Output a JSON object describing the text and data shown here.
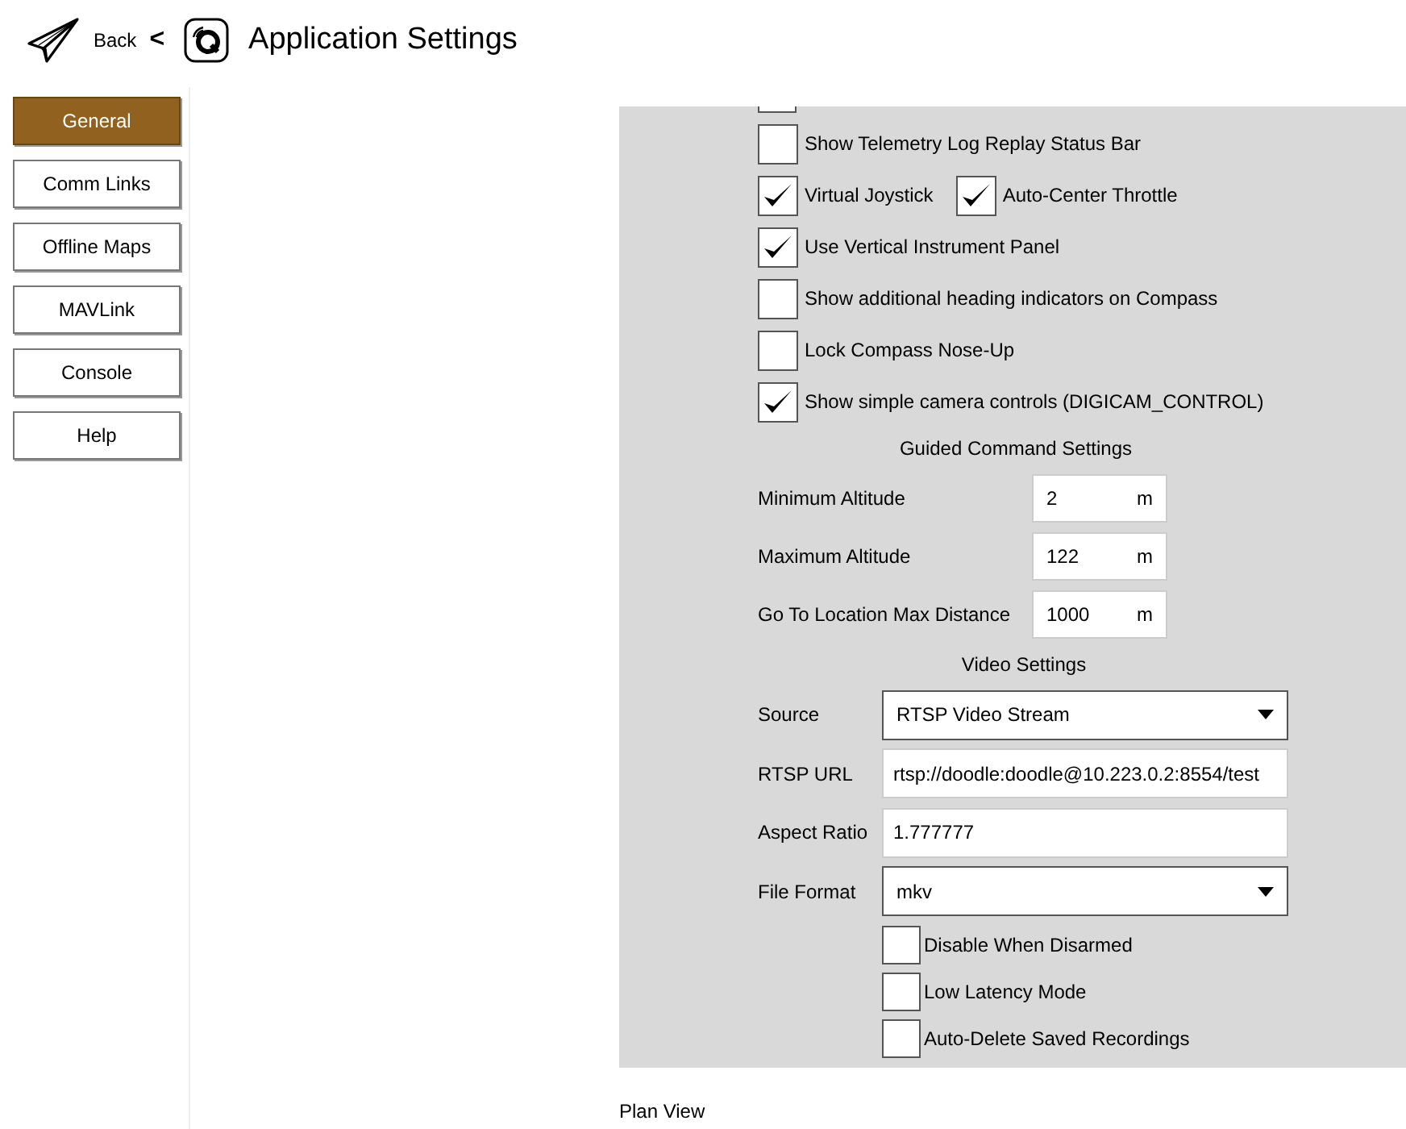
{
  "header": {
    "back_label": "Back",
    "chevron": "<",
    "title": "Application Settings"
  },
  "sidebar": {
    "items": [
      {
        "label": "General",
        "selected": true
      },
      {
        "label": "Comm Links",
        "selected": false
      },
      {
        "label": "Offline Maps",
        "selected": false
      },
      {
        "label": "MAVLink",
        "selected": false
      },
      {
        "label": "Console",
        "selected": false
      },
      {
        "label": "Help",
        "selected": false
      }
    ]
  },
  "partial_checkbox": {
    "checked": false
  },
  "checkbox_rows": [
    [
      {
        "label": "Show Telemetry Log Replay Status Bar",
        "checked": false
      }
    ],
    [
      {
        "label": "Virtual Joystick",
        "checked": true
      },
      {
        "label": "Auto-Center Throttle",
        "checked": true
      }
    ],
    [
      {
        "label": "Use Vertical Instrument Panel",
        "checked": true
      }
    ],
    [
      {
        "label": "Show additional heading indicators on Compass",
        "checked": false
      }
    ],
    [
      {
        "label": "Lock Compass Nose-Up",
        "checked": false
      }
    ],
    [
      {
        "label": "Show simple camera controls (DIGICAM_CONTROL)",
        "checked": true
      }
    ]
  ],
  "guided": {
    "title": "Guided Command Settings",
    "fields": [
      {
        "label": "Minimum Altitude",
        "value": "2",
        "unit": "m"
      },
      {
        "label": "Maximum Altitude",
        "value": "122",
        "unit": "m"
      },
      {
        "label": "Go To Location Max Distance",
        "value": "1000",
        "unit": "m"
      }
    ]
  },
  "video": {
    "title": "Video Settings",
    "rows": [
      {
        "kind": "select",
        "label": "Source",
        "value": "RTSP Video Stream"
      },
      {
        "kind": "text",
        "label": "RTSP URL",
        "value": "rtsp://doodle:doodle@10.223.0.2:8554/test"
      },
      {
        "kind": "text",
        "label": "Aspect Ratio",
        "value": "1.777777"
      },
      {
        "kind": "select",
        "label": "File Format",
        "value": "mkv"
      }
    ],
    "checkboxes": [
      {
        "label": "Disable When Disarmed",
        "checked": false
      },
      {
        "label": "Low Latency Mode",
        "checked": false
      },
      {
        "label": "Auto-Delete Saved Recordings",
        "checked": false
      }
    ]
  },
  "next_section": "Plan View"
}
